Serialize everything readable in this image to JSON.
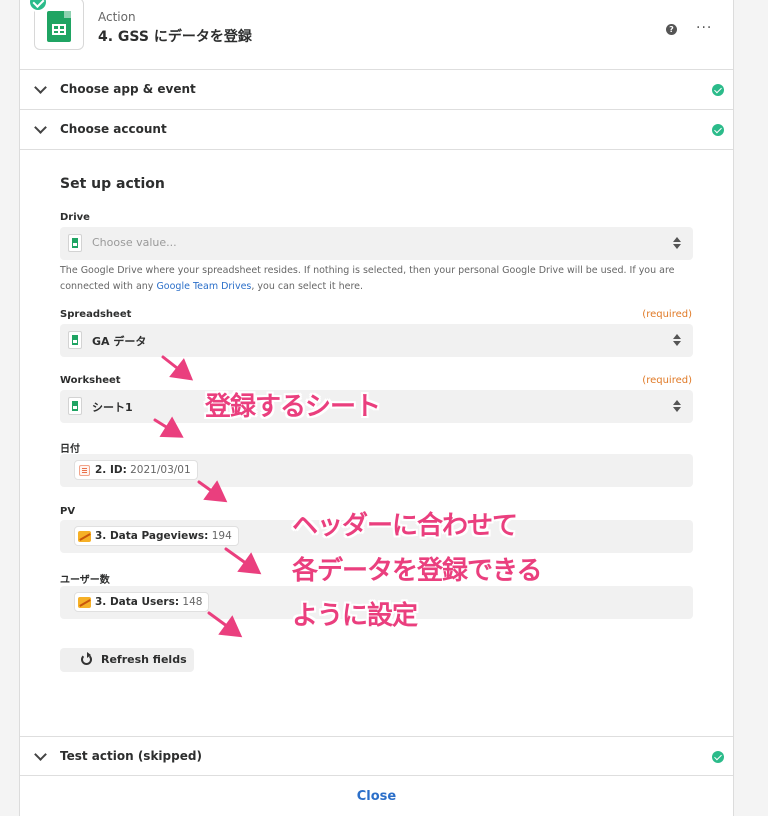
{
  "header": {
    "kind": "Action",
    "title": "4. GSS にデータを登録",
    "help_glyph": "?",
    "more_glyph": "···"
  },
  "rows": {
    "app_event": "Choose app & event",
    "account": "Choose account",
    "test": "Test action (skipped)"
  },
  "setup": {
    "title": "Set up action",
    "drive": {
      "label": "Drive",
      "placeholder": "Choose value...",
      "help_before": "The Google Drive where your spreadsheet resides. If nothing is selected, then your personal Google Drive will be used. If you are connected with any ",
      "help_link": "Google Team Drives",
      "help_after": ", you can select it here."
    },
    "spreadsheet": {
      "label": "Spreadsheet",
      "required": "(required)",
      "value": "GA データ"
    },
    "worksheet": {
      "label": "Worksheet",
      "required": "(required)",
      "value": "シート1"
    },
    "date": {
      "label": "日付",
      "key": "2. ID:",
      "value": "2021/03/01"
    },
    "pv": {
      "label": "PV",
      "key": "3. Data Pageviews:",
      "value": "194"
    },
    "users": {
      "label": "ユーザー数",
      "key": "3. Data Users:",
      "value": "148"
    },
    "refresh_label": "Refresh fields"
  },
  "footer": {
    "close_label": "Close"
  },
  "annotations": {
    "sheet_note": "登録するシート",
    "line1": "ヘッダーに合わせて",
    "line2": "各データを登録できる",
    "line3": "ように設定"
  },
  "colors": {
    "accent_pink": "#ea3f7e",
    "success": "#2bbb8a",
    "link": "#2b6fc9",
    "required": "#e07a27"
  }
}
